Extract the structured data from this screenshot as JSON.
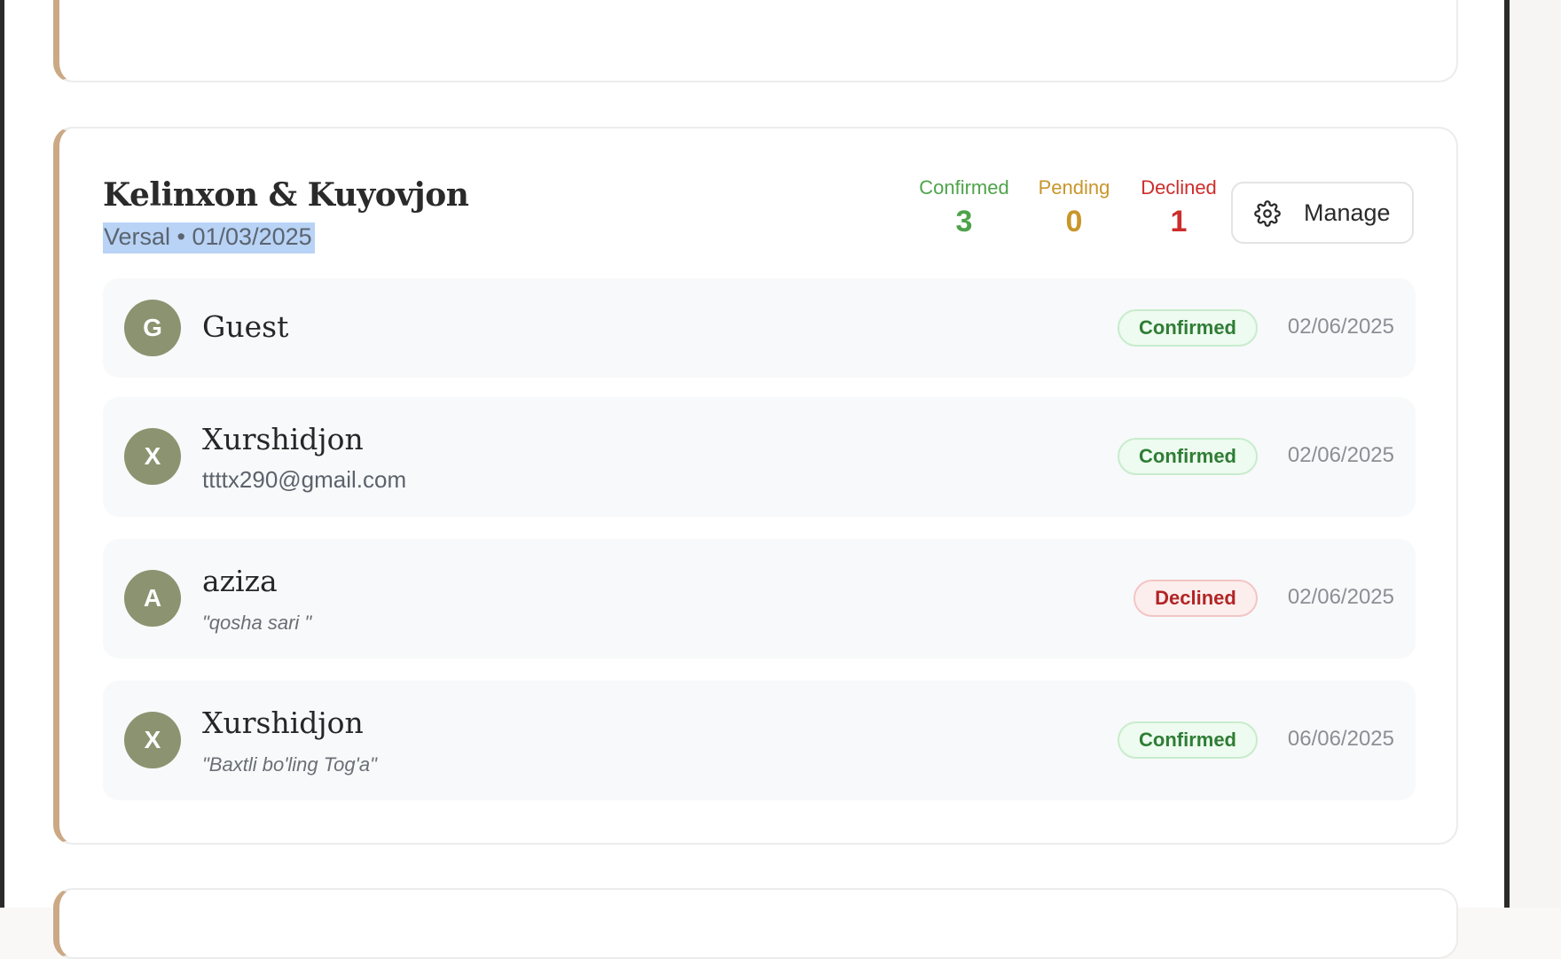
{
  "event": {
    "title": "Kelinxon & Kuyovjon",
    "meta": "Versal • 01/03/2025"
  },
  "stats": {
    "confirmed": {
      "label": "Confirmed",
      "value": "3",
      "color": "#4ea34a"
    },
    "pending": {
      "label": "Pending",
      "value": "0",
      "color": "#c8962a"
    },
    "declined": {
      "label": "Declined",
      "value": "1",
      "color": "#cc2d2b"
    }
  },
  "manage_button": {
    "label": "Manage",
    "icon": "gear-icon"
  },
  "guests": [
    {
      "initial": "G",
      "name": "Guest",
      "sub": "",
      "status": "Confirmed",
      "date": "02/06/2025"
    },
    {
      "initial": "X",
      "name": "Xurshidjon",
      "sub": "ttttx290@gmail.com",
      "status": "Confirmed",
      "date": "02/06/2025"
    },
    {
      "initial": "A",
      "name": "aziza",
      "sub": "\"qosha sari \"",
      "status": "Declined",
      "date": "02/06/2025"
    },
    {
      "initial": "X",
      "name": "Xurshidjon",
      "sub": "\"Baxtli bo'ling Tog'a\"",
      "status": "Confirmed",
      "date": "06/06/2025"
    }
  ],
  "colors": {
    "accent_border": "#cba985",
    "avatar_bg": "#8b9370",
    "selection_highlight": "#b8d3f5"
  }
}
